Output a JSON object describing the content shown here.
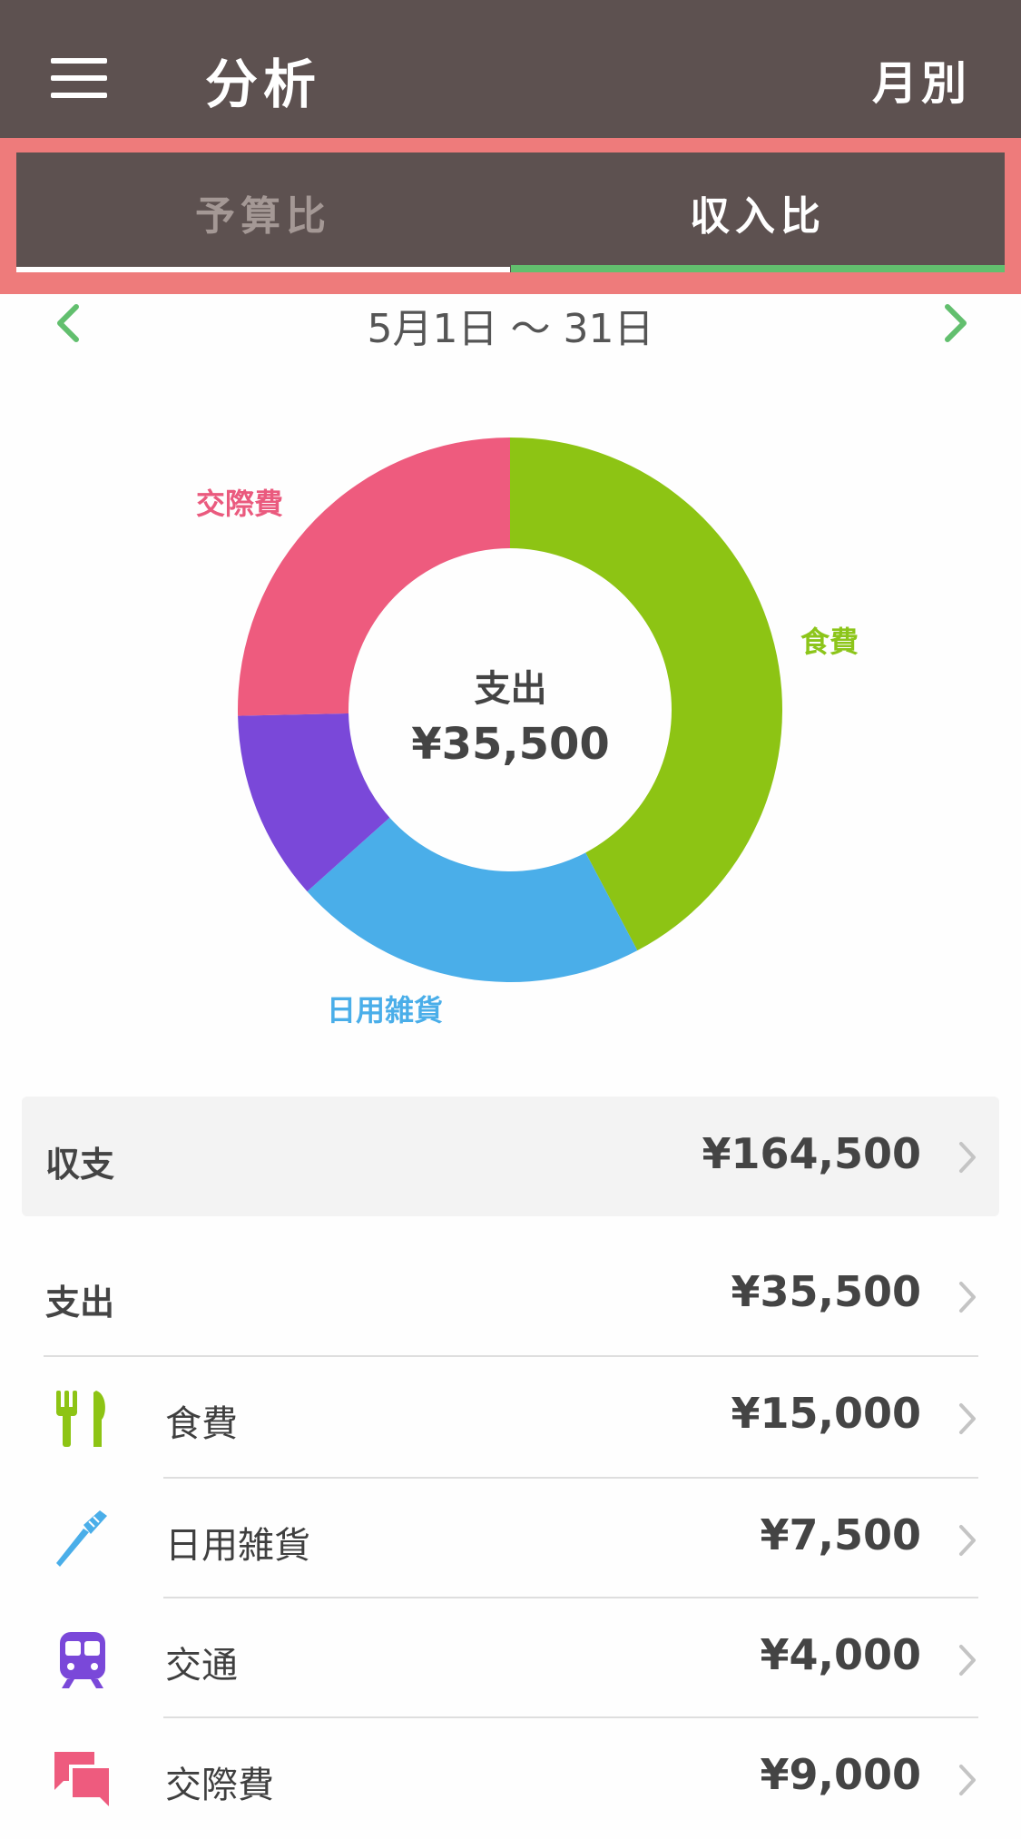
{
  "header": {
    "title": "分析",
    "period_button": "月別"
  },
  "tabs": [
    {
      "label": "予算比",
      "selected": false
    },
    {
      "label": "収入比",
      "selected": true
    }
  ],
  "date_range": "5月1日 〜 31日",
  "colors": {
    "header_bg": "#5d5150",
    "highlight_frame": "#ee7b7b",
    "accent_green": "#62bf6e"
  },
  "chart_data": {
    "type": "pie",
    "center_label": "支出",
    "center_value": "¥35,500",
    "slices": [
      {
        "label": "食費",
        "value": 15000,
        "color": "#8dc414"
      },
      {
        "label": "日用雑貨",
        "value": 7500,
        "color": "#4aaee9"
      },
      {
        "label": "",
        "value": 4000,
        "color": "#7a48d9"
      },
      {
        "label": "交際費",
        "value": 9000,
        "color": "#ee5b7e"
      }
    ]
  },
  "summary": {
    "label": "収支",
    "amount": "¥164,500"
  },
  "expense": {
    "label": "支出",
    "amount": "¥35,500"
  },
  "categories": [
    {
      "name": "食費",
      "amount": "¥15,000",
      "icon": "fork-knife-icon",
      "color": "#8dc414"
    },
    {
      "name": "日用雑貨",
      "amount": "¥7,500",
      "icon": "toothbrush-icon",
      "color": "#4aaee9"
    },
    {
      "name": "交通",
      "amount": "¥4,000",
      "icon": "train-icon",
      "color": "#7a48d9"
    },
    {
      "name": "交際費",
      "amount": "¥9,000",
      "icon": "chat-bubbles-icon",
      "color": "#ee5b7e"
    }
  ]
}
